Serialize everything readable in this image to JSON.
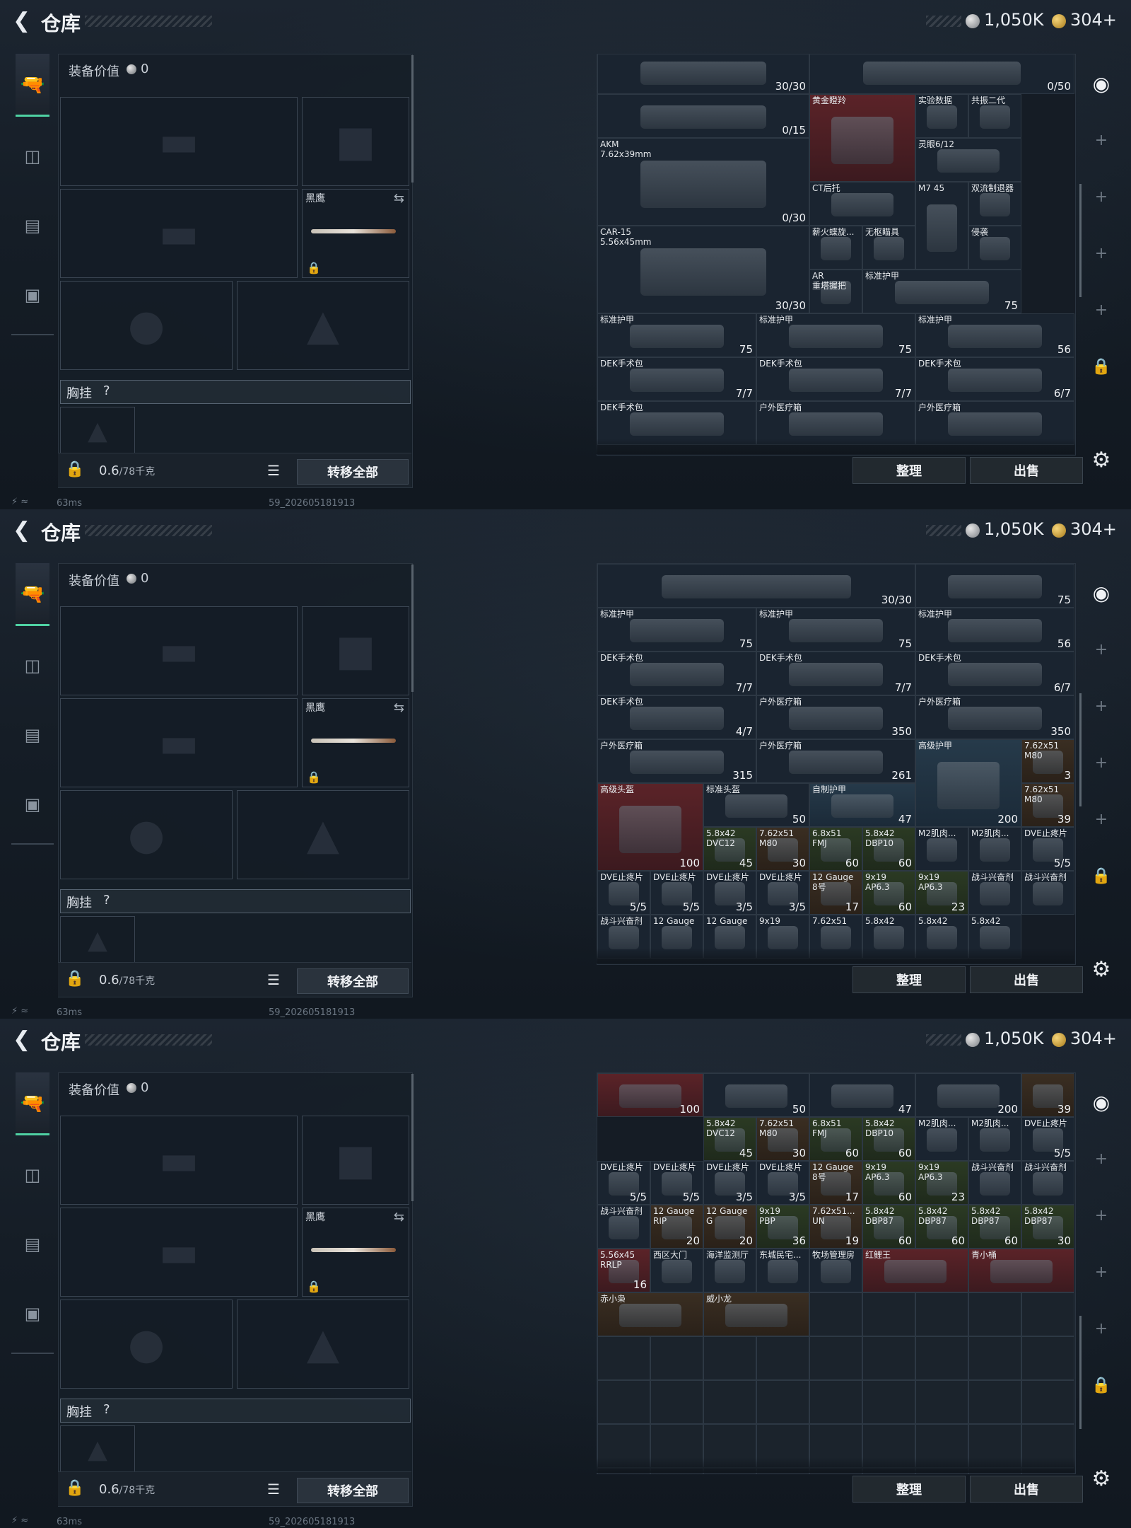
{
  "header": {
    "title": "仓库",
    "currency_silver": "1,050K",
    "currency_gold": "304+"
  },
  "equipment": {
    "value_label": "装备价值",
    "value": "0",
    "knife_label": "黑鹰",
    "chest_label": "胸挂",
    "chest_help": "?",
    "weight": "0.6",
    "weight_unit": "/78千克",
    "transfer_all": "转移全部"
  },
  "status": {
    "ping": "63ms",
    "build": "59_202605181913"
  },
  "stash_buttons": {
    "sort": "整理",
    "sell": "出售"
  },
  "icons": {
    "back": "chevron-left-icon",
    "tab_weapons": "pistol-icon",
    "tab_armor": "vest-icon",
    "tab_backpack": "backpack-icon",
    "tab_case": "briefcase-icon",
    "settings": "gear-icon"
  },
  "panels": [
    {
      "items": [
        {
          "name": "",
          "count": "30/30"
        },
        {
          "name": "",
          "count": "0/50"
        },
        {
          "name": "",
          "count": "0/15"
        },
        {
          "name": "黄金瞪羚",
          "count": ""
        },
        {
          "name": "实验数据",
          "count": ""
        },
        {
          "name": "共振二代",
          "count": ""
        },
        {
          "name": "AKM\n7.62x39mm",
          "count": "0/30"
        },
        {
          "name": "灵眼6/12",
          "count": ""
        },
        {
          "name": "CT后托",
          "count": ""
        },
        {
          "name": "M7 45",
          "count": ""
        },
        {
          "name": "双流制退器",
          "count": ""
        },
        {
          "name": "CAR-15\n5.56x45mm",
          "count": "30/30"
        },
        {
          "name": "薪火蝶旋...",
          "count": ""
        },
        {
          "name": "无枢瞄具",
          "count": ""
        },
        {
          "name": "侵袭",
          "count": ""
        },
        {
          "name": "AR\n重塔握把",
          "count": ""
        },
        {
          "name": "标准护甲",
          "count": "75"
        },
        {
          "name": "标准护甲",
          "count": "75"
        },
        {
          "name": "标准护甲",
          "count": "75"
        },
        {
          "name": "标准护甲",
          "count": "56"
        },
        {
          "name": "DEK手术包",
          "count": "7/7"
        },
        {
          "name": "DEK手术包",
          "count": "7/7"
        },
        {
          "name": "DEK手术包",
          "count": "6/7"
        },
        {
          "name": "DEK手术包",
          "count": ""
        },
        {
          "name": "户外医疗箱",
          "count": ""
        },
        {
          "name": "户外医疗箱",
          "count": ""
        }
      ]
    },
    {
      "items": [
        {
          "name": "",
          "count": "30/30"
        },
        {
          "name": "",
          "count": "75"
        },
        {
          "name": "标准护甲",
          "count": "75"
        },
        {
          "name": "标准护甲",
          "count": "75"
        },
        {
          "name": "标准护甲",
          "count": "56"
        },
        {
          "name": "DEK手术包",
          "count": "7/7"
        },
        {
          "name": "DEK手术包",
          "count": "7/7"
        },
        {
          "name": "DEK手术包",
          "count": "6/7"
        },
        {
          "name": "DEK手术包",
          "count": "4/7"
        },
        {
          "name": "户外医疗箱",
          "count": "350"
        },
        {
          "name": "户外医疗箱",
          "count": "350"
        },
        {
          "name": "户外医疗箱",
          "count": "315"
        },
        {
          "name": "户外医疗箱",
          "count": "261"
        },
        {
          "name": "高级护甲",
          "count": "200"
        },
        {
          "name": "7.62x51\nM80",
          "count": "3"
        },
        {
          "name": "高级头盔",
          "count": "100"
        },
        {
          "name": "标准头盔",
          "count": "50"
        },
        {
          "name": "自制护甲",
          "count": "47"
        },
        {
          "name": "7.62x51\nM80",
          "count": "39"
        },
        {
          "name": "5.8x42\nDVC12",
          "count": "45"
        },
        {
          "name": "7.62x51\nM80",
          "count": "30"
        },
        {
          "name": "6.8x51\nFMJ",
          "count": "60"
        },
        {
          "name": "5.8x42\nDBP10",
          "count": "60"
        },
        {
          "name": "M2肌肉...",
          "count": ""
        },
        {
          "name": "M2肌肉...",
          "count": ""
        },
        {
          "name": "DVE止疼片",
          "count": "5/5"
        },
        {
          "name": "DVE止疼片",
          "count": "5/5"
        },
        {
          "name": "DVE止疼片",
          "count": "5/5"
        },
        {
          "name": "DVE止疼片",
          "count": "3/5"
        },
        {
          "name": "DVE止疼片",
          "count": "3/5"
        },
        {
          "name": "12 Gauge\n8号",
          "count": "17"
        },
        {
          "name": "9x19\nAP6.3",
          "count": "60"
        },
        {
          "name": "9x19\nAP6.3",
          "count": "23"
        },
        {
          "name": "战斗兴奋剂",
          "count": ""
        },
        {
          "name": "战斗兴奋剂",
          "count": ""
        },
        {
          "name": "战斗兴奋剂",
          "count": ""
        },
        {
          "name": "12 Gauge",
          "count": ""
        },
        {
          "name": "12 Gauge",
          "count": ""
        },
        {
          "name": "9x19",
          "count": ""
        },
        {
          "name": "7.62x51",
          "count": ""
        },
        {
          "name": "5.8x42",
          "count": ""
        },
        {
          "name": "5.8x42",
          "count": ""
        },
        {
          "name": "5.8x42",
          "count": ""
        }
      ]
    },
    {
      "items": [
        {
          "name": "",
          "count": "50"
        },
        {
          "name": "",
          "count": "47"
        },
        {
          "name": "",
          "count": "200"
        },
        {
          "name": "",
          "count": "39"
        },
        {
          "name": "",
          "count": "100"
        },
        {
          "name": "5.8x42\nDVC12",
          "count": "45"
        },
        {
          "name": "7.62x51\nM80",
          "count": "30"
        },
        {
          "name": "6.8x51\nFMJ",
          "count": "60"
        },
        {
          "name": "5.8x42\nDBP10",
          "count": "60"
        },
        {
          "name": "M2肌肉...",
          "count": ""
        },
        {
          "name": "M2肌肉...",
          "count": ""
        },
        {
          "name": "DVE止疼片",
          "count": "5/5"
        },
        {
          "name": "DVE止疼片",
          "count": "5/5"
        },
        {
          "name": "DVE止疼片",
          "count": "5/5"
        },
        {
          "name": "DVE止疼片",
          "count": "3/5"
        },
        {
          "name": "DVE止疼片",
          "count": "3/5"
        },
        {
          "name": "12 Gauge\n8号",
          "count": "17"
        },
        {
          "name": "9x19\nAP6.3",
          "count": "60"
        },
        {
          "name": "9x19\nAP6.3",
          "count": "23"
        },
        {
          "name": "战斗兴奋剂",
          "count": ""
        },
        {
          "name": "战斗兴奋剂",
          "count": ""
        },
        {
          "name": "战斗兴奋剂",
          "count": ""
        },
        {
          "name": "12 Gauge\nRIP",
          "count": "20"
        },
        {
          "name": "12 Gauge\nG",
          "count": "20"
        },
        {
          "name": "9x19\nPBP",
          "count": "36"
        },
        {
          "name": "7.62x51...\nUN",
          "count": "19"
        },
        {
          "name": "5.8x42\nDBP87",
          "count": "60"
        },
        {
          "name": "5.8x42\nDBP87",
          "count": "60"
        },
        {
          "name": "5.8x42\nDBP87",
          "count": "60"
        },
        {
          "name": "5.8x42\nDBP87",
          "count": "30"
        },
        {
          "name": "5.56x45\nRRLP",
          "count": "16"
        },
        {
          "name": "西区大门",
          "count": ""
        },
        {
          "name": "海洋监测厅",
          "count": ""
        },
        {
          "name": "东城民宅...",
          "count": ""
        },
        {
          "name": "牧场管理房",
          "count": ""
        },
        {
          "name": "红鲤王",
          "count": ""
        },
        {
          "name": "青小桶",
          "count": ""
        },
        {
          "name": "赤小枭",
          "count": ""
        },
        {
          "name": "威小龙",
          "count": ""
        }
      ]
    }
  ]
}
